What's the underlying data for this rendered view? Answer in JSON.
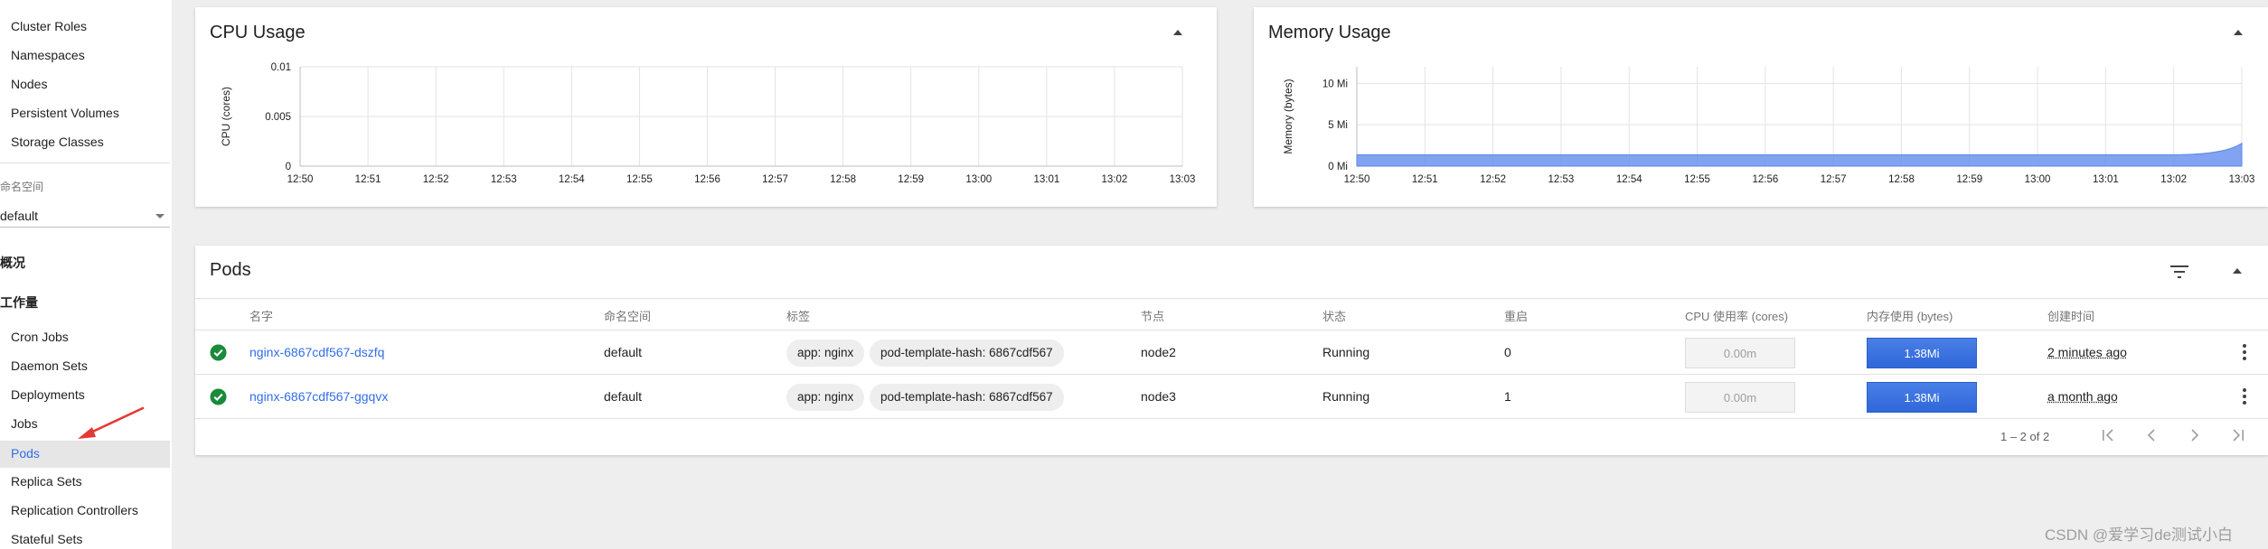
{
  "sidebar": {
    "top_items": [
      "Cluster Roles",
      "Namespaces",
      "Nodes",
      "Persistent Volumes",
      "Storage Classes"
    ],
    "namespace_label": "命名空间",
    "namespace_value": "default",
    "overview_label": "概况",
    "workloads_label": "工作量",
    "workload_items": [
      "Cron Jobs",
      "Daemon Sets",
      "Deployments",
      "Jobs",
      "Pods",
      "Replica Sets",
      "Replication Controllers",
      "Stateful Sets"
    ],
    "active_item": "Pods"
  },
  "cpu_card": {
    "title": "CPU Usage"
  },
  "memory_card": {
    "title": "Memory Usage"
  },
  "chart_data": [
    {
      "type": "line",
      "title": "CPU Usage",
      "xlabel": "",
      "ylabel": "CPU (cores)",
      "x": [
        "12:50",
        "12:51",
        "12:52",
        "12:53",
        "12:54",
        "12:55",
        "12:56",
        "12:57",
        "12:58",
        "12:59",
        "13:00",
        "13:01",
        "13:02",
        "13:03"
      ],
      "y_ticks": [
        "0",
        "0.005",
        "0.01"
      ],
      "ylim": [
        0,
        0.01
      ],
      "series": [],
      "grid": true
    },
    {
      "type": "area",
      "title": "Memory Usage",
      "xlabel": "",
      "ylabel": "Memory (bytes)",
      "x": [
        "12:50",
        "12:51",
        "12:52",
        "12:53",
        "12:54",
        "12:55",
        "12:56",
        "12:57",
        "12:58",
        "12:59",
        "13:00",
        "13:01",
        "13:02",
        "13:03"
      ],
      "y_ticks": [
        "0 Mi",
        "5 Mi",
        "10 Mi"
      ],
      "ylim": [
        0,
        12
      ],
      "series": [
        {
          "values": [
            1.38,
            1.38,
            1.38,
            1.38,
            1.38,
            1.38,
            1.38,
            1.38,
            1.38,
            1.38,
            1.38,
            1.38,
            1.38,
            2.76
          ],
          "color": "#6b93ee"
        }
      ],
      "grid": true
    }
  ],
  "pods": {
    "title": "Pods",
    "columns": [
      "名字",
      "命名空间",
      "标签",
      "节点",
      "状态",
      "重启",
      "CPU 使用率 (cores)",
      "内存使用 (bytes)",
      "创建时间"
    ],
    "rows": [
      {
        "name": "nginx-6867cdf567-dszfq",
        "namespace": "default",
        "labels": [
          "app: nginx",
          "pod-template-hash: 6867cdf567"
        ],
        "node": "node2",
        "status": "Running",
        "restarts": "0",
        "cpu": "0.00m",
        "memory": "1.38Mi",
        "age": "2 minutes ago"
      },
      {
        "name": "nginx-6867cdf567-ggqvx",
        "namespace": "default",
        "labels": [
          "app: nginx",
          "pod-template-hash: 6867cdf567"
        ],
        "node": "node3",
        "status": "Running",
        "restarts": "1",
        "cpu": "0.00m",
        "memory": "1.38Mi",
        "age": "a month ago"
      }
    ],
    "range_label": "1 – 2 of 2"
  },
  "colors": {
    "accent": "#326de6",
    "running": "#1b8a3a",
    "annotation_arrow": "#e53935"
  },
  "watermark": "CSDN @爱学习de测试小白"
}
